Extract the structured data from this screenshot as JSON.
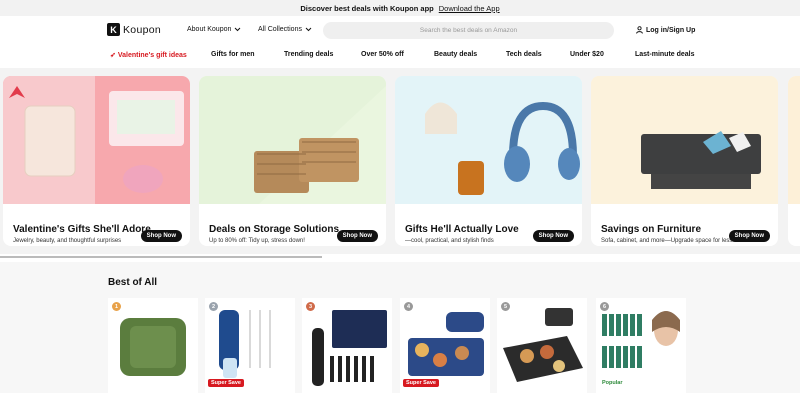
{
  "banner": {
    "text": "Discover best deals with Koupon app",
    "link": "Download the App"
  },
  "header": {
    "logo_letter": "K",
    "logo_text": "Koupon",
    "about": "About Koupon",
    "collections": "All Collections",
    "search_placeholder": "Search the best deals on Amazon",
    "login": "Log in/Sign Up"
  },
  "categories": [
    {
      "label": "Valentine's gift ideas"
    },
    {
      "label": "Gifts for men"
    },
    {
      "label": "Trending deals"
    },
    {
      "label": "Over 50% off"
    },
    {
      "label": "Beauty deals"
    },
    {
      "label": "Tech deals"
    },
    {
      "label": "Under $20"
    },
    {
      "label": "Last-minute deals"
    }
  ],
  "hero_cards": [
    {
      "title": "Valentine's Gifts She'll Adore",
      "sub": "Jewelry, beauty, and thoughtful surprises",
      "cta": "Shop Now",
      "bg": "#f7a8ad"
    },
    {
      "title": "Deals on Storage Solutions",
      "sub": "Up to 80% off: Tidy up, stress down!",
      "cta": "Shop Now",
      "bg": "#eaf6df"
    },
    {
      "title": "Gifts He'll Actually Love",
      "sub": "—cool, practical, and stylish finds",
      "cta": "Shop Now",
      "bg": "#e3f4f8"
    },
    {
      "title": "Savings on Furniture",
      "sub": "Sofa, cabinet, and more—Upgrade space for less",
      "cta": "Shop Now",
      "bg": "#fcf2dc"
    }
  ],
  "best": {
    "title": "Best of All",
    "items": [
      {
        "rank": "1",
        "badge": ""
      },
      {
        "rank": "2",
        "badge": "Super Save"
      },
      {
        "rank": "3",
        "badge": ""
      },
      {
        "rank": "4",
        "badge": "Super Save"
      },
      {
        "rank": "5",
        "badge": ""
      },
      {
        "rank": "6",
        "badge": "Popular"
      }
    ]
  }
}
